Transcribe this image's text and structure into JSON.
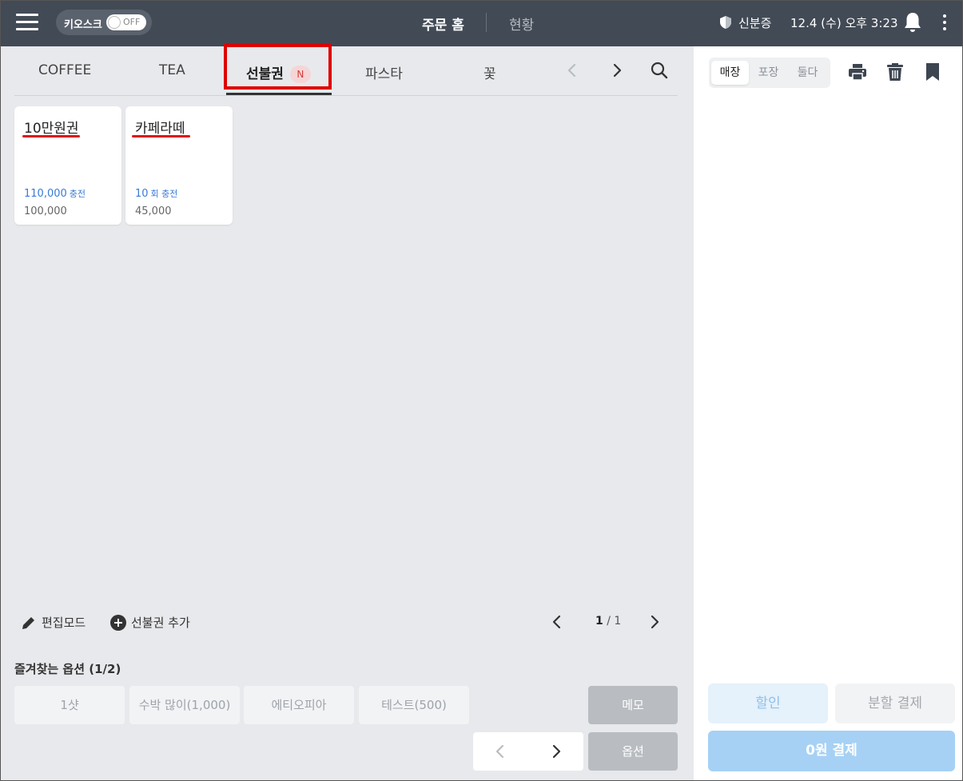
{
  "header": {
    "kiosk_label": "키오스크",
    "kiosk_toggle": "OFF",
    "nav_home": "주문 홈",
    "nav_status": "현황",
    "id_label": "신분증",
    "datetime": "12.4 (수) 오후 3:23"
  },
  "tabs": [
    {
      "label": "COFFEE",
      "active": false
    },
    {
      "label": "TEA",
      "active": false
    },
    {
      "label": "선불권",
      "active": true,
      "badge": "N"
    },
    {
      "label": "파스타",
      "active": false
    },
    {
      "label": "꽃",
      "active": false
    }
  ],
  "cards": [
    {
      "name": "10만원권",
      "charge_value": "110,000",
      "charge_unit": "충전",
      "price": "100,000"
    },
    {
      "name": "카페라떼",
      "charge_value": "10",
      "charge_unit": "회 충전",
      "price": "45,000"
    }
  ],
  "toolbar": {
    "edit_mode": "편집모드",
    "add_voucher": "선불권 추가",
    "page_current": "1",
    "page_total": "1"
  },
  "favorites": {
    "title": "즐겨찾는 옵션 (1/2)",
    "options": [
      "1샷",
      "수박 많이(1,000)",
      "에티오피아",
      "테스트(500)"
    ],
    "memo": "메모",
    "option": "옵션"
  },
  "order": {
    "segments": [
      "매장",
      "포장",
      "둘다"
    ],
    "active_segment": "매장",
    "discount": "할인",
    "split_pay": "분할 결제",
    "pay": "0원 결제"
  },
  "colors": {
    "header_bg": "#424a55",
    "highlight": "#e00000",
    "accent_blue": "#3a7bd5",
    "pay_button": "#a6d1f5"
  }
}
